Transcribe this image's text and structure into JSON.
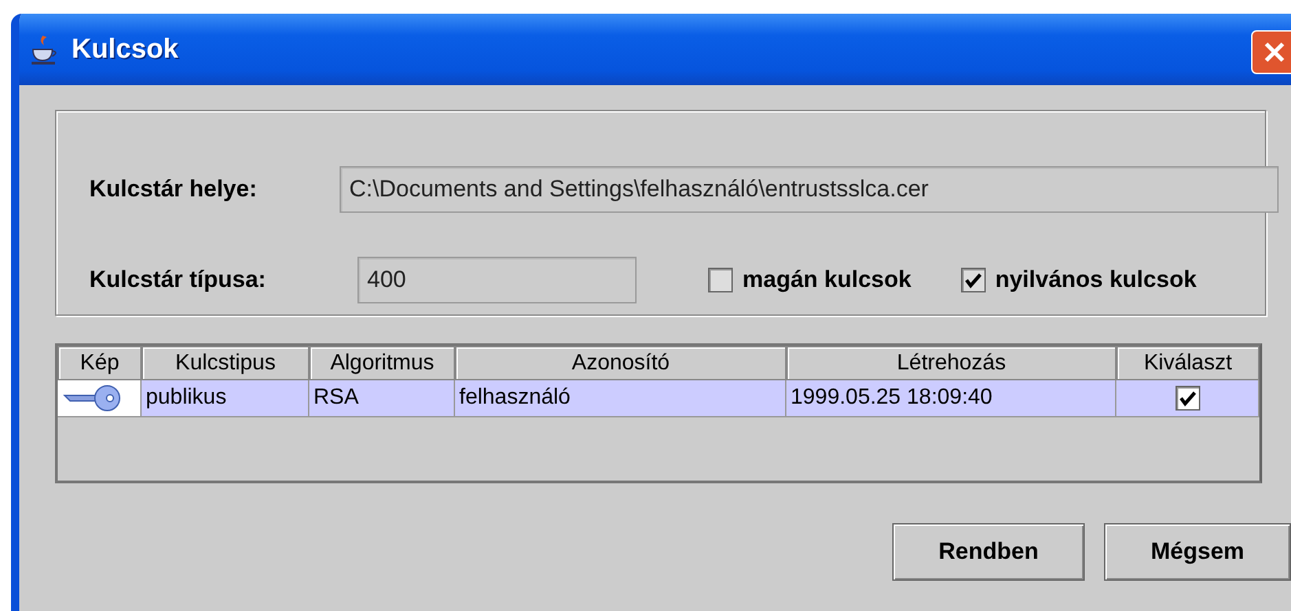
{
  "window": {
    "title": "Kulcsok"
  },
  "form": {
    "location_label": "Kulcstár helye:",
    "location_value": "C:\\Documents and Settings\\felhasználó\\entrustsslca.cer",
    "type_label": "Kulcstár típusa:",
    "type_value": "400",
    "checkboxes": [
      {
        "label": "magán kulcsok",
        "checked": false
      },
      {
        "label": "nyilvános kulcsok",
        "checked": true
      }
    ]
  },
  "table": {
    "columns": [
      "Kép",
      "Kulcstipus",
      "Algoritmus",
      "Azonosító",
      "Létrehozás",
      "Kiválaszt"
    ],
    "rows": [
      {
        "key_type": "publikus",
        "algorithm": "RSA",
        "identifier": "felhasználó",
        "created": "1999.05.25 18:09:40",
        "selected": true
      }
    ]
  },
  "buttons": [
    "Rendben",
    "Mégsem"
  ]
}
